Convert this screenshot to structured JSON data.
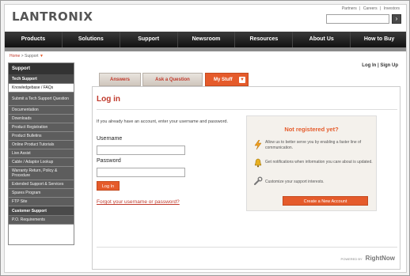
{
  "header": {
    "logo": "LANTRONIX",
    "top_links": [
      "Partners",
      "|",
      "Careers",
      "|",
      "Investors"
    ],
    "search_button": "›",
    "search_value": ""
  },
  "nav": {
    "items": [
      "Products",
      "Solutions",
      "Support",
      "Newsroom",
      "Resources",
      "About Us",
      "How to Buy"
    ]
  },
  "breadcrumb": {
    "home": "Home",
    "sep": ">",
    "current": "Support",
    "chevron": "▼"
  },
  "sidebar": {
    "heading": "Support",
    "section_tech": "Tech Support",
    "items": [
      "Knowledgebase / FAQs",
      "Submit a Tech Support Question",
      "Documentation",
      "Downloads",
      "Product Registration",
      "Product Bulletins",
      "Online Product Tutorials",
      "Live Assist",
      "Cable / Adaptor Lookup",
      "Warranty Return, Policy & Procedure",
      "Extended Support & Services",
      "Spares Program",
      "FTP Site"
    ],
    "section_customer": "Customer Support",
    "customer_items": [
      "P.O. Requirements"
    ]
  },
  "account": {
    "login": "Log In",
    "sep": "|",
    "signup": "Sign Up"
  },
  "tabs": {
    "answers": "Answers",
    "ask": "Ask a Question",
    "mystuff": "My Stuff",
    "dropdown": "▼"
  },
  "login": {
    "title": "Log in",
    "intro": "If you already have an account, enter your username and password.",
    "username_label": "Username",
    "password_label": "Password",
    "username_value": "",
    "password_value": "",
    "button": "Log In",
    "forgot": "Forgot your username or password?"
  },
  "register": {
    "title": "Not registered yet?",
    "row1": "Allow us to better serve you by enabling a faster line of communication.",
    "row2": "Get notifications when information you care about is updated.",
    "row3": "Customize your support interests.",
    "button": "Create a New Account",
    "icons": [
      "lightning-icon",
      "bell-icon",
      "wrench-icon"
    ]
  },
  "footer": {
    "powered": "POWERED BY",
    "brand": "RightNow"
  },
  "colors": {
    "accent": "#e55b2b",
    "title_red": "#c0392b",
    "nav_dark": "#111111",
    "sidebar_gray": "#5d5d5d"
  }
}
